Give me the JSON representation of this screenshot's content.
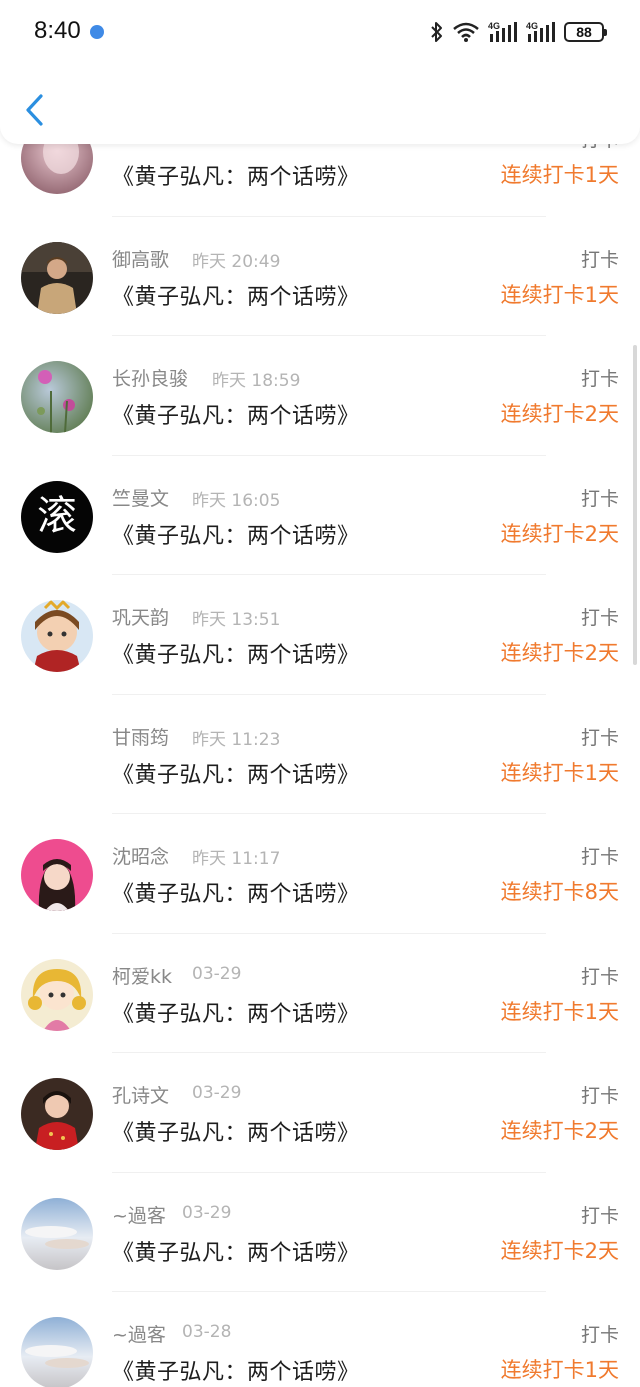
{
  "status_bar": {
    "time": "8:40",
    "battery": "88"
  },
  "list_rows": [
    {
      "name": "",
      "time": "",
      "title": "《黄子弘凡：两个话唠》",
      "tag": "打卡",
      "streak": "连续打卡1天"
    },
    {
      "name": "御高歌",
      "time": "昨天 20:49",
      "title": "《黄子弘凡：两个话唠》",
      "tag": "打卡",
      "streak": "连续打卡1天"
    },
    {
      "name": "长孙良骏",
      "time": "昨天 18:59",
      "title": "《黄子弘凡：两个话唠》",
      "tag": "打卡",
      "streak": "连续打卡2天"
    },
    {
      "name": "竺曼文",
      "time": "昨天 16:05",
      "title": "《黄子弘凡：两个话唠》",
      "tag": "打卡",
      "streak": "连续打卡2天"
    },
    {
      "name": "巩天韵",
      "time": "昨天 13:51",
      "title": "《黄子弘凡：两个话唠》",
      "tag": "打卡",
      "streak": "连续打卡2天"
    },
    {
      "name": "甘雨筠",
      "time": "昨天 11:23",
      "title": "《黄子弘凡：两个话唠》",
      "tag": "打卡",
      "streak": "连续打卡1天"
    },
    {
      "name": "沈昭念",
      "time": "昨天 11:17",
      "title": "《黄子弘凡：两个话唠》",
      "tag": "打卡",
      "streak": "连续打卡8天"
    },
    {
      "name": "柯爱kk",
      "time": "03-29",
      "title": "《黄子弘凡：两个话唠》",
      "tag": "打卡",
      "streak": "连续打卡1天"
    },
    {
      "name": "孔诗文",
      "time": "03-29",
      "title": "《黄子弘凡：两个话唠》",
      "tag": "打卡",
      "streak": "连续打卡2天"
    },
    {
      "name": "~過客",
      "time": "03-29",
      "title": "《黄子弘凡：两个话唠》",
      "tag": "打卡",
      "streak": "连续打卡2天"
    },
    {
      "name": "~過客",
      "time": "03-28",
      "title": "《黄子弘凡：两个话唠》",
      "tag": "打卡",
      "streak": "连续打卡1天"
    }
  ],
  "avatar_texts": {
    "row3": "滚"
  },
  "colors": {
    "accent_orange": "#f07a2e",
    "back_blue": "#2b8fe0",
    "name_gray": "#888888"
  }
}
